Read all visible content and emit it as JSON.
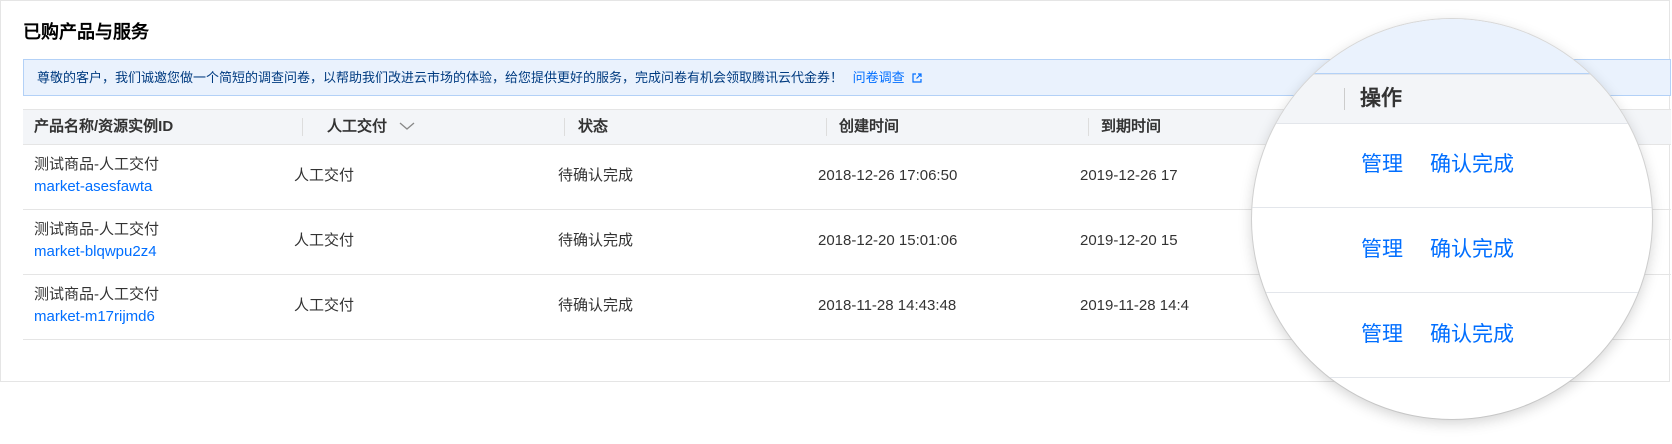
{
  "panel": {
    "title": "已购产品与服务"
  },
  "notice": {
    "text": "尊敬的客户，我们诚邀您做一个简短的调查问卷，以帮助我们改进云市场的体验，给您提供更好的服务，完成问卷有机会领取腾讯云代金券！",
    "link_label": "问卷调查",
    "link_icon": "external-link-icon"
  },
  "table": {
    "columns": {
      "name": "产品名称/资源实例ID",
      "delivery": "人工交付",
      "status": "状态",
      "created": "创建时间",
      "expire": "到期时间",
      "actions": "操作"
    },
    "rows": [
      {
        "product": "测试商品-人工交付",
        "instance_id": "market-asesfawta",
        "delivery": "人工交付",
        "status": "待确认完成",
        "created": "2018-12-26 17:06:50",
        "expire": "2019-12-26 17"
      },
      {
        "product": "测试商品-人工交付",
        "instance_id": "market-blqwpu2z4",
        "delivery": "人工交付",
        "status": "待确认完成",
        "created": "2018-12-20 15:01:06",
        "expire": "2019-12-20 15"
      },
      {
        "product": "测试商品-人工交付",
        "instance_id": "market-m17rijmd6",
        "delivery": "人工交付",
        "status": "待确认完成",
        "created": "2018-11-28 14:43:48",
        "expire": "2019-11-28 14:4"
      }
    ],
    "row_actions": {
      "manage": "管理",
      "confirm": "确认完成"
    }
  },
  "colors": {
    "link": "#006eff",
    "notice_bg": "#eaf2fd",
    "header_bg": "#f3f5f8"
  }
}
